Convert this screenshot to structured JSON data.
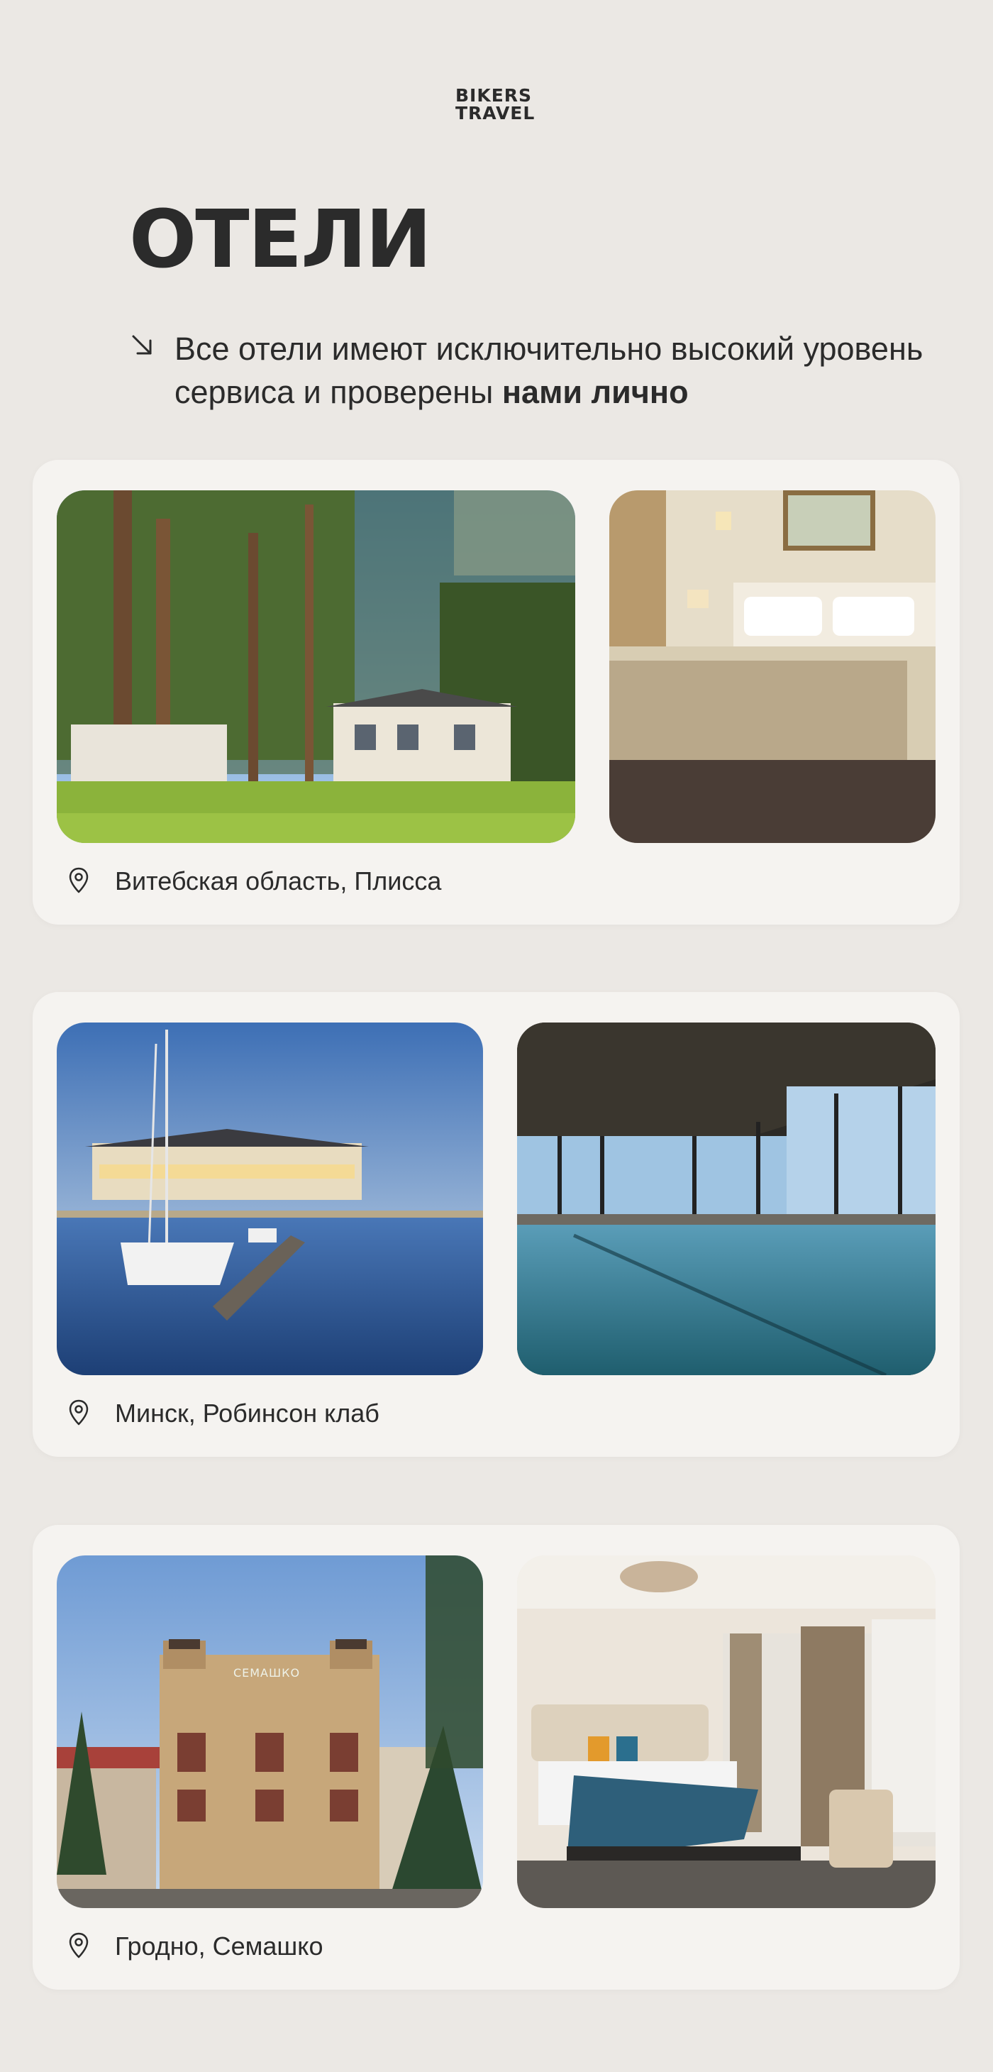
{
  "brand": {
    "line1": "BIKERS",
    "line2": "TRAVEL"
  },
  "page": {
    "title": "ОТЕЛИ",
    "subtitle_regular": "Все отели имеют исключительно высокий уровень сервиса и проверены ",
    "subtitle_bold": "нами лично"
  },
  "hotels": [
    {
      "location": "Витебская область, Плисса",
      "photos": [
        "forest-hotel-photo",
        "bedroom-photo"
      ]
    },
    {
      "location": "Минск, Робинсон клаб",
      "photos": [
        "marina-yacht-photo",
        "indoor-pool-photo"
      ]
    },
    {
      "location": "Гродно, Семашко",
      "photos": [
        "historic-building-photo",
        "hotel-room-photo"
      ],
      "sign_text": "СЕМАШКО"
    }
  ],
  "colors": {
    "background": "#ebe8e4",
    "card": "#f5f3f0",
    "text": "#2b2b2b"
  }
}
